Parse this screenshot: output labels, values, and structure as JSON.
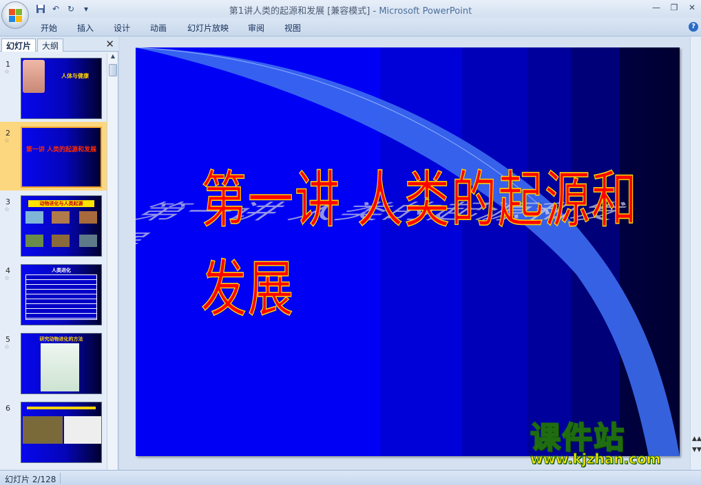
{
  "window": {
    "title": "第1讲人类的起源和发展 [兼容模式]",
    "separator": " - ",
    "app_name": "Microsoft PowerPoint"
  },
  "quick_access": {
    "icons": [
      "save-icon",
      "undo-icon",
      "redo-icon",
      "customize-dropdown-icon"
    ]
  },
  "ribbon": {
    "tabs": [
      "开始",
      "插入",
      "设计",
      "动画",
      "幻灯片放映",
      "审阅",
      "视图"
    ]
  },
  "left_panel": {
    "tab_slides": "幻灯片",
    "tab_outline": "大纲",
    "close_label": "✕",
    "slides": [
      {
        "num": "1",
        "text": "人体与健康"
      },
      {
        "num": "2",
        "text": "第一讲 人类的起源和发展"
      },
      {
        "num": "3",
        "text": "动物进化与人类起源"
      },
      {
        "num": "4",
        "text": "人类进化"
      },
      {
        "num": "5",
        "text": "研究动物进化的方法"
      },
      {
        "num": "6",
        "text": ""
      }
    ],
    "selected_slide": 2
  },
  "slide": {
    "title": "第一讲  人类的起源和发展"
  },
  "watermark": {
    "main": "课件站",
    "url": "www.kjzhan.com"
  },
  "status": {
    "slide_position": "幻灯片 2/128"
  },
  "colors": {
    "slide_blue": "#0000f4",
    "title_red": "#ff0000",
    "title_outline": "#ffcf00",
    "selected_thumb": "#fcd77f",
    "watermark_yellow": "#ffe600"
  }
}
